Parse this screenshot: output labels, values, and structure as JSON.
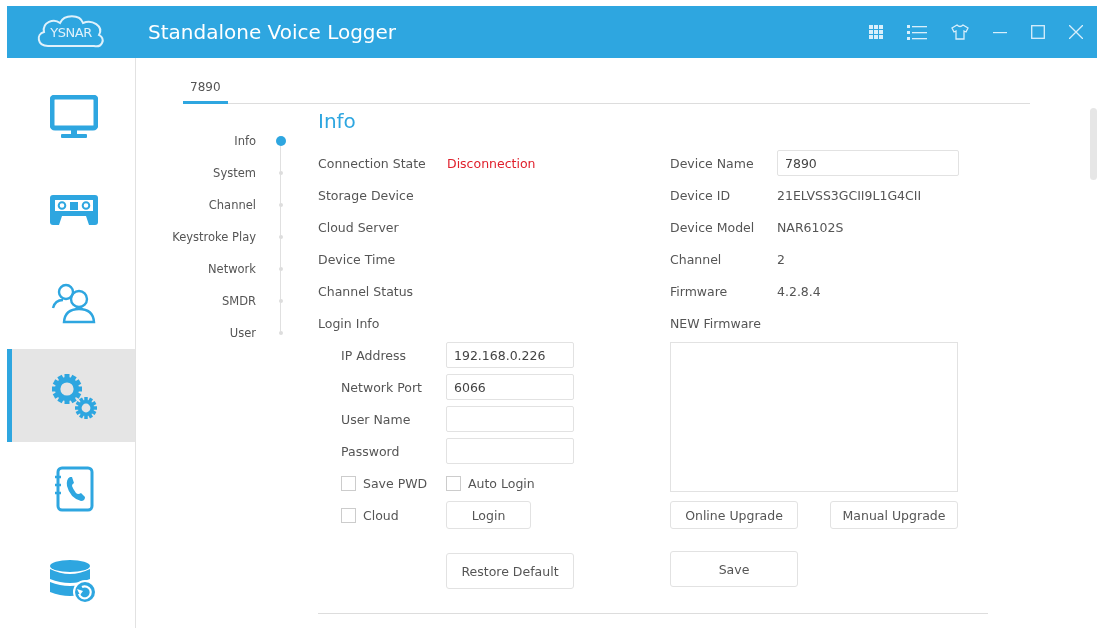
{
  "window": {
    "logo": "YSNAR",
    "title": "Standalone Voice Logger"
  },
  "sidebar": {
    "items": [
      {
        "kind": "monitor",
        "selected": false
      },
      {
        "kind": "cassette",
        "selected": false
      },
      {
        "kind": "users",
        "selected": false
      },
      {
        "kind": "gears",
        "selected": true
      },
      {
        "kind": "phonebook",
        "selected": false
      },
      {
        "kind": "database",
        "selected": false
      }
    ]
  },
  "tabs": [
    {
      "label": "7890",
      "selected": true
    }
  ],
  "section_nav": {
    "items": [
      {
        "label": "Info",
        "selected": true
      },
      {
        "label": "System",
        "selected": false
      },
      {
        "label": "Channel",
        "selected": false
      },
      {
        "label": "Keystroke Play",
        "selected": false
      },
      {
        "label": "Network",
        "selected": false
      },
      {
        "label": "SMDR",
        "selected": false
      },
      {
        "label": "User",
        "selected": false
      }
    ]
  },
  "info": {
    "heading": "Info",
    "left_fields": [
      {
        "label": "Connection State",
        "value": "Disconnection",
        "kind": "alert"
      },
      {
        "label": "Storage Device"
      },
      {
        "label": "Cloud Server"
      },
      {
        "label": "Device Time"
      },
      {
        "label": "Channel Status"
      },
      {
        "label": "Login Info"
      }
    ],
    "login": {
      "fields": [
        {
          "label": "IP Address",
          "value": "192.168.0.226"
        },
        {
          "label": "Network Port",
          "value": "6066"
        },
        {
          "label": "User Name"
        },
        {
          "label": "Password"
        }
      ],
      "options": [
        {
          "label": "Save PWD",
          "checked": false
        },
        {
          "label": "Auto Login",
          "checked": false
        },
        {
          "label": "Cloud",
          "checked": false
        }
      ],
      "login_button": "Login"
    },
    "restore_button": "Restore Default",
    "right_fields": [
      {
        "label": "Device Name",
        "value": "7890",
        "kind": "input"
      },
      {
        "label": "Device ID",
        "value": "21ELVSS3GCII9L1G4CII",
        "kind": "text"
      },
      {
        "label": "Device Model",
        "value": "NAR6102S",
        "kind": "text"
      },
      {
        "label": "Channel",
        "value": "2",
        "kind": "text"
      },
      {
        "label": "Firmware",
        "value": "4.2.8.4",
        "kind": "text"
      },
      {
        "label": "NEW Firmware",
        "kind": "text"
      }
    ],
    "upgrade_buttons": [
      "Online Upgrade",
      "Manual Upgrade"
    ],
    "save_button": "Save"
  }
}
